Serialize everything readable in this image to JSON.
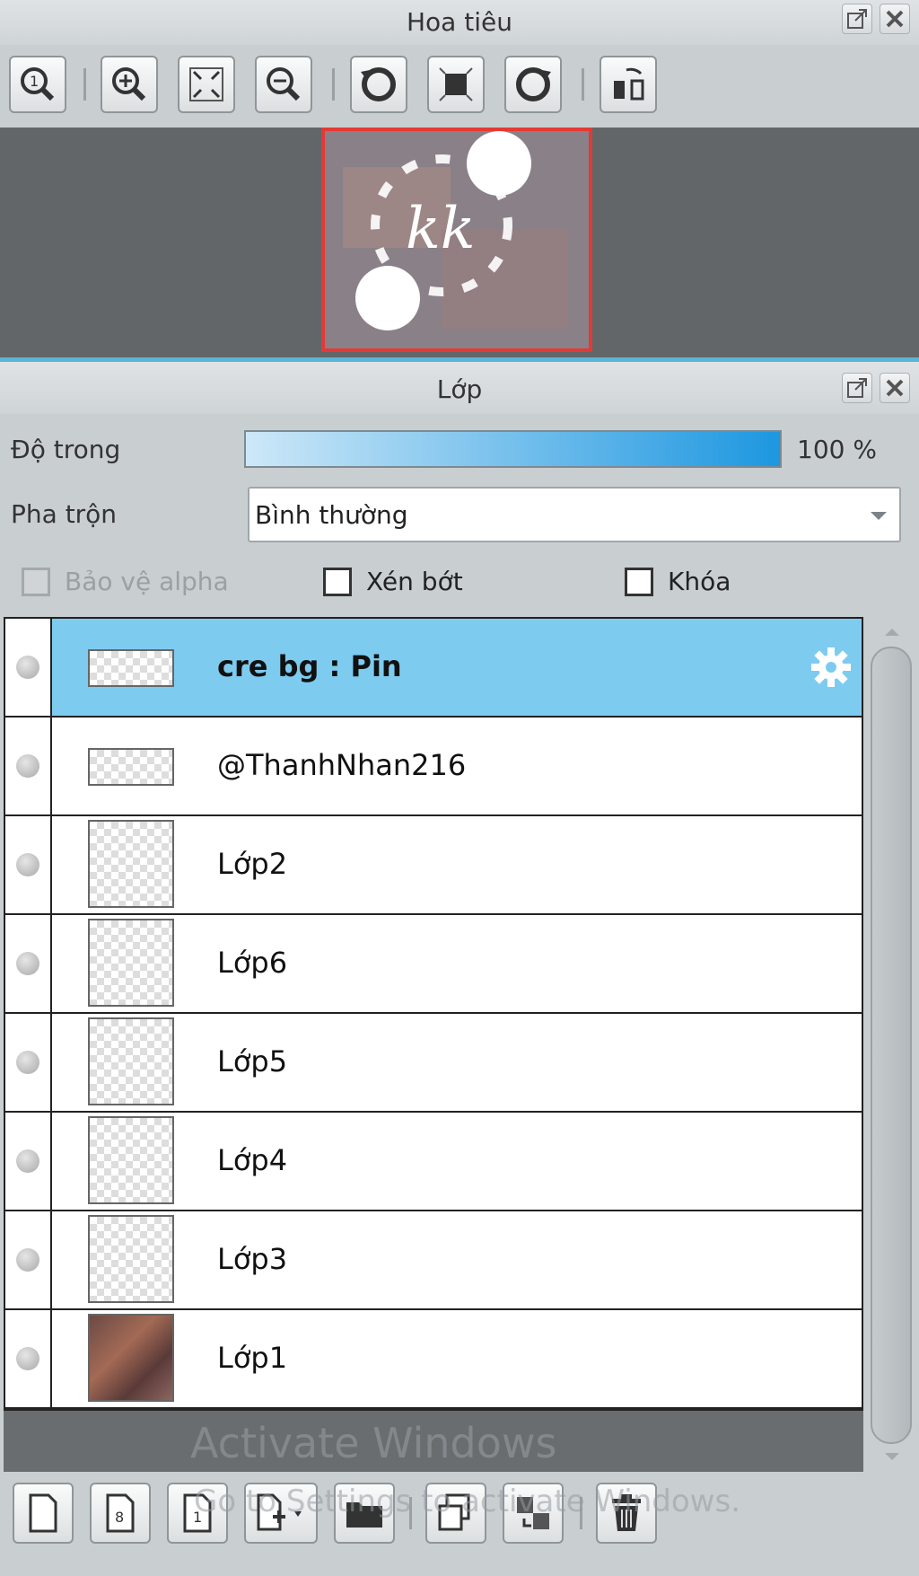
{
  "navigator": {
    "title": "Hoa tiêu",
    "toolbar": [
      {
        "name": "zoom-actual-size-icon"
      },
      {
        "name": "zoom-in-icon"
      },
      {
        "name": "zoom-fit-icon"
      },
      {
        "name": "zoom-out-icon"
      },
      {
        "name": "rotate-left-icon"
      },
      {
        "name": "reset-rotation-icon"
      },
      {
        "name": "rotate-right-icon"
      },
      {
        "name": "flip-horizontal-icon"
      }
    ],
    "thumbnail_text": "kk"
  },
  "layers_panel": {
    "title": "Lớp",
    "opacity_label": "Độ trong",
    "opacity_value": "100 %",
    "opacity": 1.0,
    "blend_label": "Pha trộn",
    "blend_value": "Bình thường",
    "checkboxes": [
      {
        "label": "Bảo vệ alpha",
        "checked": false,
        "disabled": true
      },
      {
        "label": "Xén bớt",
        "checked": false,
        "disabled": false
      },
      {
        "label": "Khóa",
        "checked": false,
        "disabled": false
      }
    ],
    "layers": [
      {
        "name": "cre bg : Pin",
        "selected": true
      },
      {
        "name": "@ThanhNhan216",
        "selected": false
      },
      {
        "name": "Lớp2",
        "selected": false
      },
      {
        "name": "Lớp6",
        "selected": false
      },
      {
        "name": "Lớp5",
        "selected": false
      },
      {
        "name": "Lớp4",
        "selected": false
      },
      {
        "name": "Lớp3",
        "selected": false
      },
      {
        "name": "Lớp1",
        "selected": false
      }
    ],
    "footer_buttons": [
      {
        "name": "new-layer-icon"
      },
      {
        "name": "new-8bit-layer-icon"
      },
      {
        "name": "new-1bit-layer-icon"
      },
      {
        "name": "add-layer-dropdown-icon"
      },
      {
        "name": "new-folder-icon"
      },
      {
        "name": "copy-layer-icon"
      },
      {
        "name": "merge-layer-icon"
      },
      {
        "name": "delete-layer-icon"
      }
    ]
  },
  "watermark": {
    "line1": "Activate Windows",
    "line2": "Go to Settings to activate Windows."
  },
  "colors": {
    "selected_row": "#7ecbf0",
    "accent_line": "#5ab6d8",
    "nav_frame": "#e53935"
  }
}
